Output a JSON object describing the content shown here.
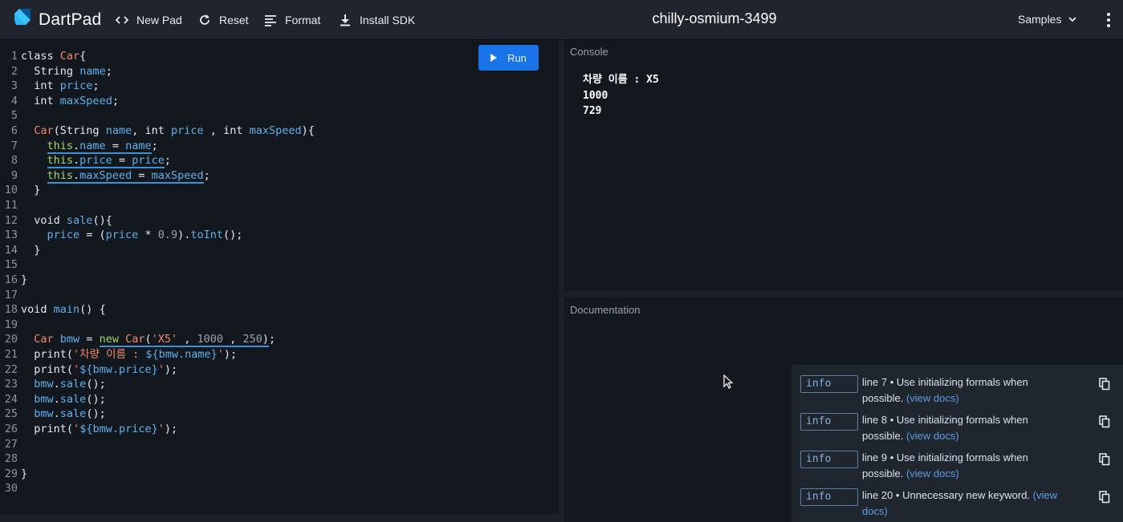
{
  "header": {
    "app_name": "DartPad",
    "new_pad": "New Pad",
    "reset": "Reset",
    "format": "Format",
    "install_sdk": "Install SDK",
    "pad_title": "chilly-osmium-3499",
    "samples": "Samples"
  },
  "editor": {
    "run_label": "Run",
    "line_numbers": [
      "1",
      "2",
      "3",
      "4",
      "5",
      "6",
      "7",
      "8",
      "9",
      "10",
      "11",
      "12",
      "13",
      "14",
      "15",
      "16",
      "17",
      "18",
      "19",
      "20",
      "21",
      "22",
      "23",
      "24",
      "25",
      "26",
      "27",
      "28",
      "29",
      "30"
    ],
    "tokens": {
      "class": "class",
      "Car": "Car",
      "lbrace": "{",
      "rbrace": "}",
      "String": "String",
      "int": "int",
      "void": "void",
      "new": "new",
      "this": "this",
      "print": "print",
      "name": "name",
      "price": "price",
      "maxSpeed": "maxSpeed",
      "sale": "sale",
      "main": "main",
      "toInt": "toInt",
      "bmw": "bmw",
      "str_x5": "'X5'",
      "num_1000": "1000",
      "num_250": "250",
      "num_09": "0.9",
      "str_open": "'",
      "str_korean": "'차량 이름 : ",
      "interp_name": "${bmw.name}",
      "interp_price": "${bmw.price}"
    }
  },
  "console": {
    "label": "Console",
    "lines": [
      "차량 이름 : X5",
      "1000",
      "729"
    ]
  },
  "documentation": {
    "label": "Documentation"
  },
  "issues": [
    {
      "kind": "info",
      "text": "line 7 • Use initializing formals when possible.",
      "link": "(view docs)"
    },
    {
      "kind": "info",
      "text": "line 8 • Use initializing formals when possible.",
      "link": "(view docs)"
    },
    {
      "kind": "info",
      "text": "line 9 • Use initializing formals when possible.",
      "link": "(view docs)"
    },
    {
      "kind": "info",
      "text": "line 20 • Unnecessary new keyword.",
      "link": "(view docs)"
    }
  ],
  "colors": {
    "accent": "#1a73e8",
    "background": "#13181f",
    "header": "#20252d",
    "class_name": "#f0886b",
    "identifier": "#5fb0ec",
    "this_keyword": "#a8d56f",
    "link": "#5f9de0"
  },
  "icons": [
    "dart-logo-icon",
    "code-brackets-icon",
    "reset-icon",
    "format-icon",
    "download-icon",
    "chevron-down-icon",
    "more-vert-icon",
    "play-icon",
    "copy-icon",
    "mouse-cursor-icon"
  ]
}
